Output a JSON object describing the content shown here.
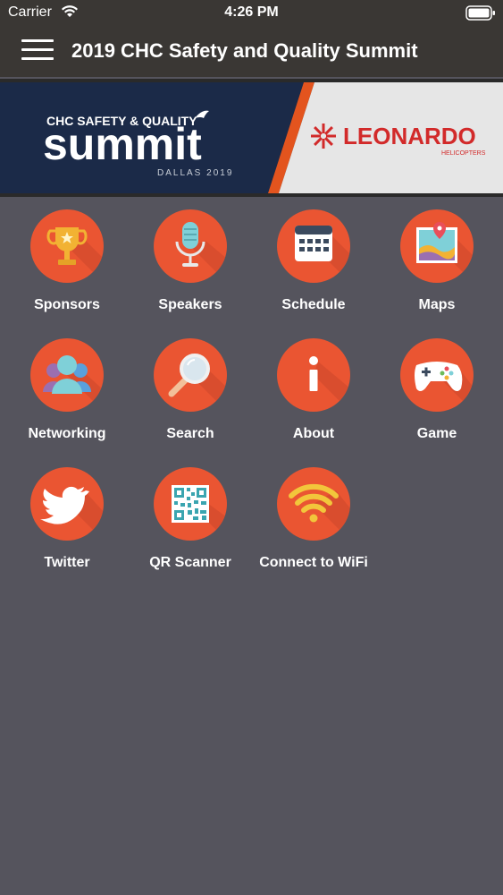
{
  "status_bar": {
    "carrier": "Carrier",
    "time": "4:26 PM"
  },
  "nav": {
    "title": "2019 CHC Safety and Quality Summit"
  },
  "banner": {
    "line1": "CHC SAFETY & QUALITY",
    "line2": "summit",
    "line3": "DALLAS 2019",
    "sponsor": "LEONARDO",
    "sponsor_sub": "HELICOPTERS"
  },
  "colors": {
    "accent": "#ea5532",
    "background": "#55545d",
    "bar": "#3a3734",
    "banner_navy": "#1b2a48"
  },
  "tiles": [
    {
      "label": "Sponsors",
      "icon": "trophy-icon"
    },
    {
      "label": "Speakers",
      "icon": "microphone-icon"
    },
    {
      "label": "Schedule",
      "icon": "calendar-icon"
    },
    {
      "label": "Maps",
      "icon": "map-icon"
    },
    {
      "label": "Networking",
      "icon": "people-icon"
    },
    {
      "label": "Search",
      "icon": "magnifier-icon"
    },
    {
      "label": "About",
      "icon": "info-icon"
    },
    {
      "label": "Game",
      "icon": "gamepad-icon"
    },
    {
      "label": "Twitter",
      "icon": "twitter-bird-icon"
    },
    {
      "label": "QR Scanner",
      "icon": "qr-code-icon"
    },
    {
      "label": "Connect to WiFi",
      "icon": "wifi-icon"
    }
  ]
}
